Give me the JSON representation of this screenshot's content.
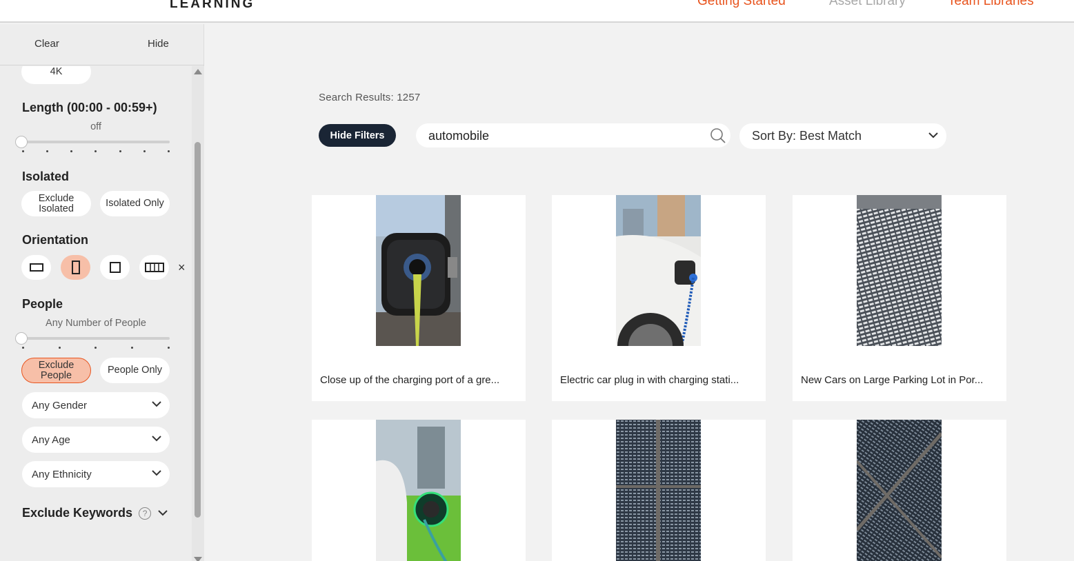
{
  "header": {
    "logo_text": "LEARNING",
    "nav": [
      {
        "label": "Getting Started",
        "color": "#e8541e"
      },
      {
        "label": "Asset Library",
        "color": "#a8a8a8"
      },
      {
        "label": "Team Libraries",
        "color": "#e8541e"
      }
    ]
  },
  "sidebar": {
    "clear_label": "Clear",
    "hide_label": "Hide",
    "resolution_option": "4K",
    "length": {
      "title": "Length (00:00 - 00:59+)",
      "value_text": "off"
    },
    "isolated": {
      "title": "Isolated",
      "options": [
        "Exclude Isolated",
        "Isolated Only"
      ]
    },
    "orientation": {
      "title": "Orientation",
      "options": [
        "landscape-icon",
        "portrait-icon",
        "square-icon",
        "panoramic-icon"
      ],
      "selected": "portrait-icon",
      "clear_symbol": "×"
    },
    "people": {
      "title": "People",
      "count_text": "Any Number of People",
      "options": [
        "Exclude People",
        "People Only"
      ],
      "selected": "Exclude People",
      "gender": "Any Gender",
      "age": "Any Age",
      "ethnicity": "Any Ethnicity"
    },
    "exclude_keywords": {
      "title": "Exclude Keywords",
      "help_symbol": "?"
    }
  },
  "main": {
    "results_text": "Search Results: 1257",
    "hide_filters_label": "Hide Filters",
    "search_value": "automobile",
    "sort_label": "Sort By: Best Match",
    "accent_color": "#e8541e",
    "cards": [
      {
        "caption": "Close up of the charging port of a gre..."
      },
      {
        "caption": "Electric car plug in with charging stati..."
      },
      {
        "caption": "New Cars on Large Parking Lot in Por..."
      },
      {
        "caption": ""
      },
      {
        "caption": ""
      },
      {
        "caption": ""
      }
    ]
  }
}
